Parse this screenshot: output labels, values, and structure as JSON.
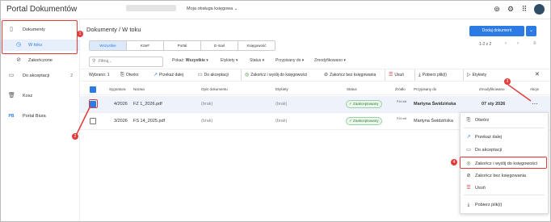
{
  "header": {
    "brand": "Portal Dokumentów",
    "company_redacted": "",
    "assistant_label": "Moja obsługa księgowa",
    "icons": [
      "help-icon",
      "gear-icon",
      "apps-grid-icon",
      "user-avatar"
    ]
  },
  "sidebar": {
    "items": [
      {
        "label": "Dokumenty",
        "icon": "document-icon"
      },
      {
        "label": "W toku",
        "icon": "clock-icon"
      },
      {
        "label": "Zakończone",
        "icon": "check-circle-icon"
      },
      {
        "label": "Do akceptacji",
        "icon": "document-arrow-icon",
        "badge": "2"
      },
      {
        "label": "Kosz",
        "icon": "trash-icon"
      },
      {
        "label": "Portal Biura",
        "icon": "pb-icon",
        "icon_text": "PB"
      }
    ]
  },
  "page": {
    "title": "Dokumenty / W toku",
    "add_button": "Dodaj dokument",
    "tabs": [
      "Wszystkie",
      "KSeF",
      "Portal",
      "E-mail",
      "Księgowość"
    ],
    "active_tab": "Wszystkie",
    "pager": "1-2 z 2"
  },
  "filters": {
    "search_placeholder": "Filtruj...",
    "show_label": "Pokaż:",
    "show_value": "Wszystkie",
    "tags": "Etykiety",
    "status": "Status",
    "assigned": "Przypisany do",
    "modified": "Zmodyfikowano"
  },
  "actions": {
    "selected": "Wybrano: 1",
    "open": "Otwórz",
    "forward": "Przekaż dalej",
    "to_accept": "Do akceptacji",
    "finish_send": "Zakończ i wyślij do księgowości",
    "finish_no_post": "Zakończ bez księgowania",
    "delete": "Usuń",
    "download": "Pobierz plik(i)",
    "tags": "Etykiety"
  },
  "table": {
    "columns": [
      "Sygnatura",
      "Nazwa",
      "Opis dokumentu",
      "Etykiety",
      "Status",
      "Źródło",
      "Przypisany do",
      "Zmodyfikowano",
      "Akcje"
    ],
    "rows": [
      {
        "signature": "4/2026",
        "name": "FZ 1_2026.pdf",
        "description": "(brak)",
        "tags": "(brak)",
        "status": "Zaakceptowany",
        "source": "P24 edt",
        "assigned": "Martyna Świdzińska",
        "modified": "07 sty 2026",
        "selected": true
      },
      {
        "signature": "3/2026",
        "name": "FS 14_2025.pdf",
        "description": "(brak)",
        "tags": "(brak)",
        "status": "Zaakceptowany",
        "source": "P24 edt",
        "assigned": "Martyna Świdzińska",
        "modified": "",
        "selected": false
      }
    ]
  },
  "context_menu": {
    "items": [
      {
        "label": "Otwórz",
        "icon": "open-document-icon"
      },
      {
        "label": "Przekaż dalej",
        "icon": "forward-arrow-icon"
      },
      {
        "label": "Do akceptacji",
        "icon": "document-arrow-icon"
      },
      {
        "label": "Zakończ i wyślij do księgowości",
        "icon": "check-circle-icon"
      },
      {
        "label": "Zakończ bez księgowania",
        "icon": "no-entry-icon"
      },
      {
        "label": "Usuń",
        "icon": "trash-icon"
      },
      {
        "label": "Pobierz plik(i)",
        "icon": "download-icon"
      }
    ]
  },
  "annotations": [
    "1",
    "2",
    "3",
    "4"
  ],
  "colors": {
    "accent": "#2c7be5",
    "annotation": "#e33b3b",
    "status_green": "#2e7d32"
  }
}
